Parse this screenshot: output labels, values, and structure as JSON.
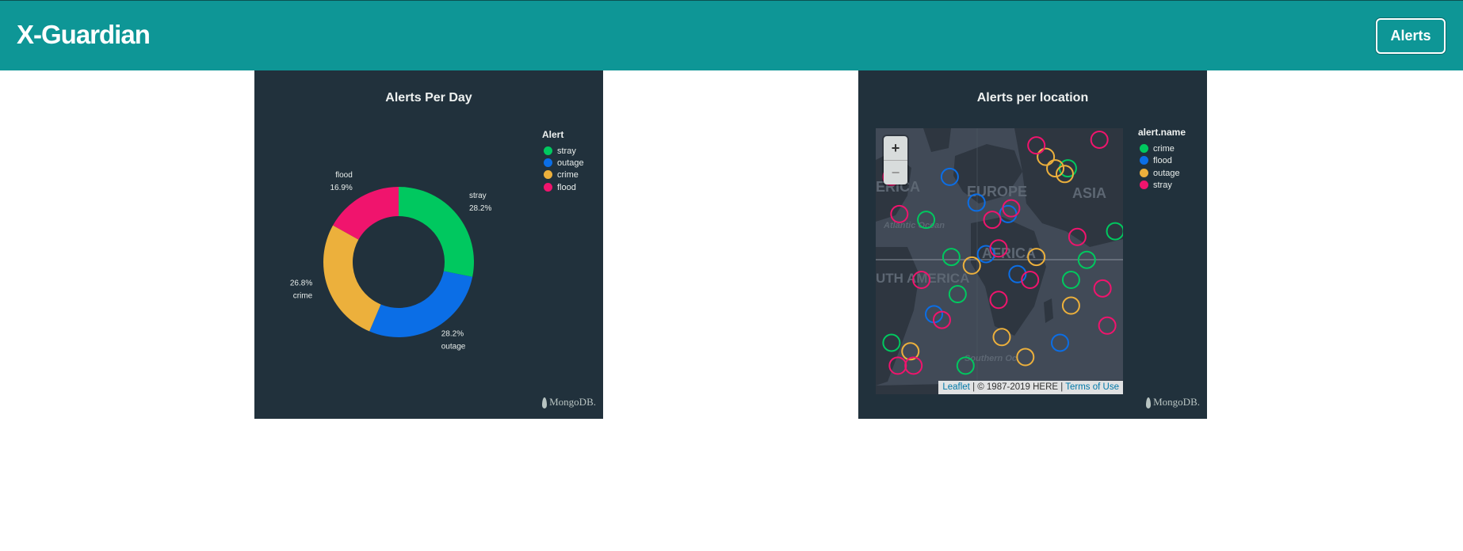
{
  "navbar": {
    "brand": "X-Guardian",
    "alerts_button": "Alerts",
    "color": "#0e9696"
  },
  "charts": {
    "alerts_per_day": {
      "title": "Alerts Per Day",
      "legend_title": "Alert",
      "legend": [
        "stray",
        "outage",
        "crime",
        "flood"
      ],
      "watermark": "MongoDB."
    },
    "alerts_per_location": {
      "title": "Alerts per location",
      "legend_title": "alert.name",
      "legend": [
        "crime",
        "flood",
        "outage",
        "stray"
      ],
      "watermark": "MongoDB.",
      "zoom_in": "+",
      "zoom_out": "−",
      "attribution": {
        "leaflet": "Leaflet",
        "copyright": "| © 1987-2019 HERE |",
        "terms": "Terms of Use"
      },
      "map_labels": [
        "ERICA",
        "EUROPE",
        "ASIA",
        "AFRICA",
        "UTH AMERICA",
        "Atlantic Ocean",
        "Southern Oc"
      ]
    }
  },
  "chart_data": [
    {
      "type": "pie",
      "title": "Alerts Per Day",
      "donut": true,
      "legend_position": "top-right",
      "slices": [
        {
          "name": "stray",
          "percent": 28.2,
          "label": "28.2%",
          "color": "#00c85f"
        },
        {
          "name": "outage",
          "percent": 28.2,
          "label": "28.2%",
          "color": "#0b6ee6"
        },
        {
          "name": "crime",
          "percent": 26.8,
          "label": "26.8%",
          "color": "#ecb03c"
        },
        {
          "name": "flood",
          "percent": 16.9,
          "label": "16.9%",
          "color": "#f0146d"
        }
      ]
    },
    {
      "type": "scatter",
      "title": "Alerts per location",
      "legend_position": "top-right",
      "series": [
        {
          "name": "crime",
          "color": "#00c85f",
          "points": [
            [
              -30,
              18
            ],
            [
              -10,
              -8
            ],
            [
              60,
              36
            ],
            [
              62,
              -3
            ],
            [
              72,
              4
            ],
            [
              90,
              14
            ],
            [
              -52,
              -25
            ],
            [
              -14,
              5
            ],
            [
              -5,
              -33
            ]
          ]
        },
        {
          "name": "flood",
          "color": "#0b6ee6",
          "points": [
            [
              -15,
              33
            ],
            [
              2,
              24
            ],
            [
              22,
              20
            ],
            [
              8,
              6
            ],
            [
              28,
              -1
            ],
            [
              -25,
              -15
            ],
            [
              55,
              -25
            ]
          ]
        },
        {
          "name": "outage",
          "color": "#ecb03c",
          "points": [
            [
              46,
              40
            ],
            [
              52,
              36
            ],
            [
              58,
              34
            ],
            [
              -1,
              2
            ],
            [
              40,
              5
            ],
            [
              62,
              -12
            ],
            [
              18,
              -23
            ],
            [
              33,
              -30
            ],
            [
              -40,
              -28
            ]
          ]
        },
        {
          "name": "stray",
          "color": "#f0146d",
          "points": [
            [
              -52,
              33
            ],
            [
              40,
              44
            ],
            [
              80,
              46
            ],
            [
              -47,
              20
            ],
            [
              24,
              22
            ],
            [
              12,
              18
            ],
            [
              16,
              8
            ],
            [
              36,
              -3
            ],
            [
              -33,
              -3
            ],
            [
              -20,
              -17
            ],
            [
              16,
              -10
            ],
            [
              85,
              -19
            ],
            [
              -48,
              -33
            ],
            [
              -38,
              -33
            ],
            [
              66,
              12
            ],
            [
              82,
              -6
            ]
          ]
        }
      ]
    }
  ]
}
